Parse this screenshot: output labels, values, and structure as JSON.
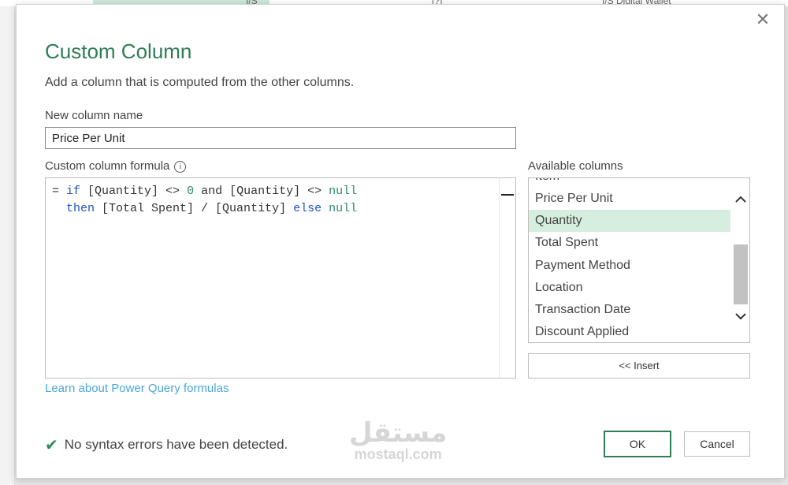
{
  "background": {
    "cell_texts": [
      "I/S",
      "[?]",
      "I/S Digital Wallet"
    ]
  },
  "dialog": {
    "title": "Custom Column",
    "subtitle": "Add a column that is computed from the other columns.",
    "close_icon": "close-icon"
  },
  "new_column": {
    "label": "New column name",
    "value": "Price Per Unit"
  },
  "formula": {
    "label": "Custom column formula",
    "info_icon": "info-icon",
    "line1": {
      "eq": "= ",
      "if": "if",
      "p1": " [Quantity] <> ",
      "zero": "0",
      "and": " and ",
      "p2": "[Quantity] <> ",
      "null1": "null"
    },
    "line2": {
      "indent": "  ",
      "then": "then",
      "p3": " [Total Spent] / [Quantity] ",
      "else": "else",
      "sp": " ",
      "null2": "null"
    }
  },
  "available_columns": {
    "label": "Available columns",
    "items": [
      {
        "label": "Item"
      },
      {
        "label": "Price Per Unit"
      },
      {
        "label": "Quantity"
      },
      {
        "label": "Total Spent"
      },
      {
        "label": "Payment Method"
      },
      {
        "label": "Location"
      },
      {
        "label": "Transaction Date"
      },
      {
        "label": "Discount Applied"
      }
    ],
    "selected": "Quantity",
    "insert_label": "<< Insert"
  },
  "learn_link": "Learn about Power Query formulas",
  "status": {
    "icon": "checkmark-icon",
    "text": "No syntax errors have been detected."
  },
  "watermark": {
    "arabic": "مستقل",
    "latin": "mostaql.com"
  },
  "buttons": {
    "ok": "OK",
    "cancel": "Cancel"
  },
  "colors": {
    "accent": "#2e7d55",
    "selected_row": "#d6eee0",
    "link": "#4aa7d8",
    "keyword_blue": "#1e53c7",
    "keyword_green": "#2e8b6e"
  }
}
